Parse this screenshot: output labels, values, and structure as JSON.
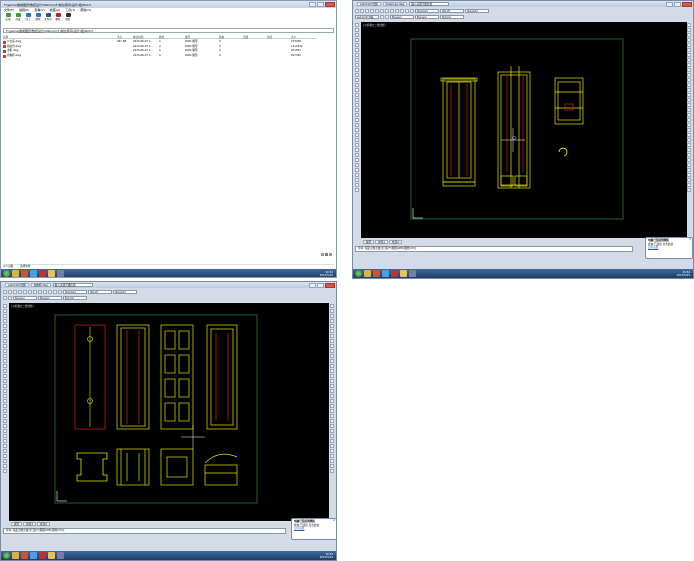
{
  "explorer": {
    "title": "F:\\game\\魔戒图纸\\数控设计\\CNC(A)\\大\\前台家具\\设计\\组\\RVC3",
    "menu": [
      "文件(F)",
      "编辑(E)",
      "查看(V)",
      "收藏(A)",
      "工具(T)",
      "帮助(H)"
    ],
    "nav": [
      "后退",
      "前进",
      "向上",
      "搜索",
      "文件夹",
      "删除",
      "属性"
    ],
    "address": "F:\\game\\魔戒图纸\\数控设计\\CNC(A)\\大\\前台家具\\设计\\组\\RVC3",
    "columns": [
      "名称",
      "大小",
      "修改时间",
      "属性",
      "类型",
      "版本",
      "创建",
      "访问",
      "大小"
    ],
    "files": [
      {
        "name": "公主床.dwg",
        "size": "267 KB",
        "date": "2015-06-07 1...",
        "attr": "A",
        "type": "DWG 图形",
        "ver": "9",
        "bytes": "273456"
      },
      {
        "name": "梳妆台.dwg",
        "size": "",
        "date": "2015-06-07 1...",
        "attr": "A",
        "type": "DWG 图形",
        "ver": "9",
        "bytes": "1215410"
      },
      {
        "name": "书柜.dwg",
        "size": "",
        "date": "2015-06-07 1...",
        "attr": "A",
        "type": "DWG 图形",
        "ver": "9",
        "bytes": "971567"
      },
      {
        "name": "衣橱柜.dwg",
        "size": "",
        "date": "2015-06-07 1...",
        "attr": "A",
        "type": "DWG 图形",
        "ver": "9",
        "bytes": "817320"
      }
    ],
    "status": "4 个对象",
    "status2": "选择文件",
    "clock": "16:52\n2015/5/24"
  },
  "cad_top": {
    "tab1": "AutoCAD 经典",
    "tab2": "Drawing1.dwg",
    "search": "输入关键字或短语",
    "combo_style": "Standard",
    "combo_iso": "ISO-25",
    "combo_layer": "ByLayer",
    "combo_linetype": "ByLayer",
    "combo_color": "ByColor",
    "workspace": "AutoCAD 经典",
    "view_label": "[-][俯视][二维线框]",
    "tabs": [
      "模型",
      "布局1",
      "布局2"
    ],
    "command": "命令: 指定对角点或 [栏选(F)/圈围(WP)/圈交(CP)]:",
    "notif_title": "电脑已连接到网络",
    "notif_body": "状态:已连接 点击此处",
    "notif_link": "显示设置",
    "clock": "16:52\n2015/5/24"
  },
  "cad_bottom": {
    "tab1": "AutoCAD 经典",
    "tab2": "衣橱柜.dwg",
    "search": "输入关键字或短语",
    "combo_style": "Standard",
    "combo_iso": "ISO-25",
    "combo_layer": "ByLayer",
    "combo_color": "ByColor",
    "view_label": "[-][俯视][二维线框]",
    "tabs": [
      "模型",
      "布局1",
      "布局2"
    ],
    "command": "命令: 指定对角点或 [栏选(F)/圈围(WP)/圈交(CP)]:",
    "notif_title": "电脑已连接到网络",
    "notif_body": "状态:已连接 点击此处",
    "notif_link": "显示设置",
    "clock": "16:52\n2015/5/24"
  },
  "colors": {
    "cad_bg": "#000000",
    "cad_yellow": "#e6e600",
    "cad_red": "#d22020",
    "cad_green": "#2f7a2f",
    "taskbar": "#2a4d7e"
  }
}
